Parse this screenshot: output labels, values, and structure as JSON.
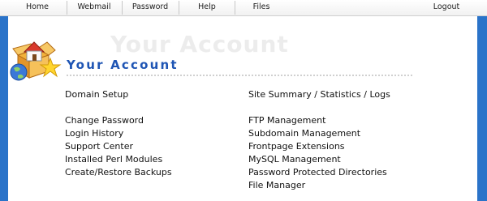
{
  "nav": {
    "home": "Home",
    "webmail": "Webmail",
    "password": "Password",
    "help": "Help",
    "files": "Files",
    "logout": "Logout"
  },
  "header": {
    "title": "Your Account",
    "watermark": "Your Account"
  },
  "left_links": [
    "Domain Setup",
    "Change Password",
    "Login History",
    "Support Center",
    "Installed Perl Modules",
    "Create/Restore Backups"
  ],
  "right_links": [
    "Site Summary / Statistics / Logs",
    "FTP Management",
    "Subdomain Management",
    "Frontpage Extensions",
    "MySQL Management",
    "Password Protected Directories",
    "File Manager"
  ],
  "colors": {
    "background": "#2a73c9",
    "title": "#1f55b4"
  },
  "icons": {
    "logo": "house-box-globe-star-icon"
  }
}
